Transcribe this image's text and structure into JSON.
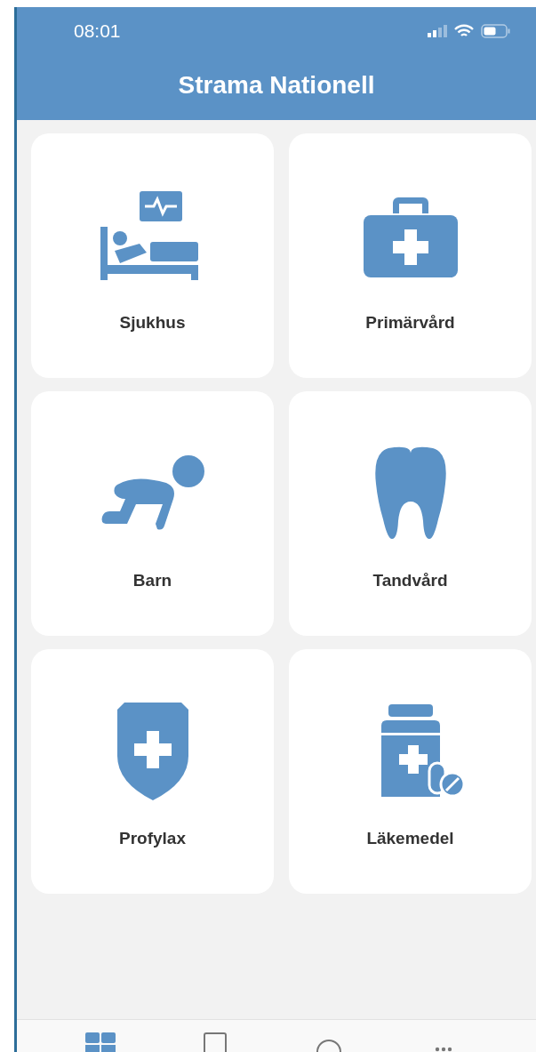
{
  "status_bar": {
    "time": "08:01"
  },
  "header": {
    "title": "Strama Nationell"
  },
  "cards": [
    {
      "label": "Sjukhus",
      "kind": "hospital"
    },
    {
      "label": "Primärvård",
      "kind": "kit"
    },
    {
      "label": "Barn",
      "kind": "baby"
    },
    {
      "label": "Tandvård",
      "kind": "tooth"
    },
    {
      "label": "Profylax",
      "kind": "shield"
    },
    {
      "label": "Läkemedel",
      "kind": "medicine"
    }
  ],
  "tab_bar": [
    {
      "kind": "grid",
      "selected": true
    },
    {
      "kind": "tablet",
      "selected": false
    },
    {
      "kind": "circle",
      "selected": false
    },
    {
      "kind": "more",
      "selected": false
    }
  ]
}
